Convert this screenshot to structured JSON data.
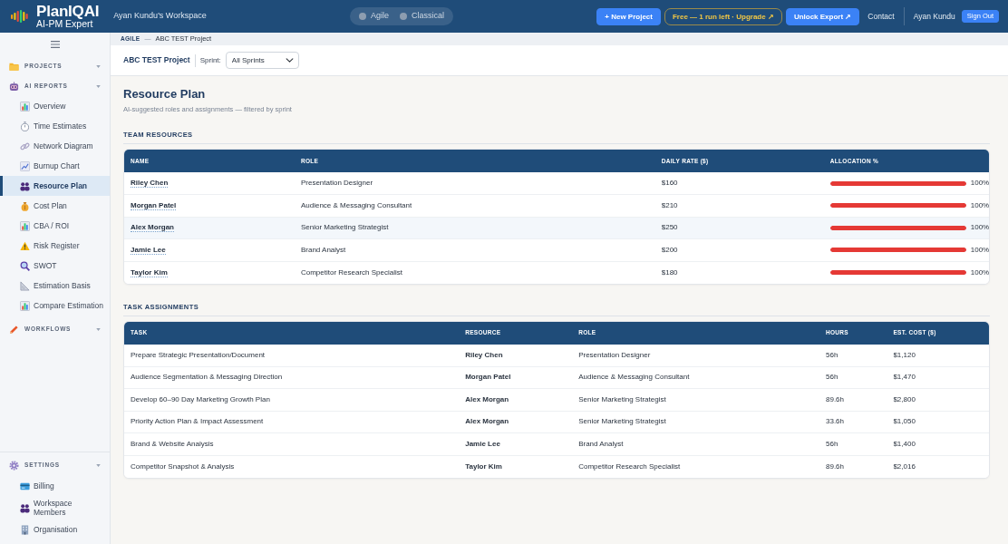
{
  "header": {
    "logo": {
      "title": "PlanIQAI",
      "subtitle": "AI-PM Expert"
    },
    "workspace": "Ayan Kundu's Workspace",
    "modes": [
      {
        "label": "Agile",
        "selected": false
      },
      {
        "label": "Classical",
        "selected": false
      }
    ],
    "new_project": "+ New Project",
    "upgrade": "Free — 1 run left · Upgrade ↗",
    "unlock_export": "Unlock Export ↗",
    "contact": "Contact",
    "user": "Ayan Kundu",
    "sign_out": "Sign Out"
  },
  "sidebar": {
    "sections": [
      {
        "label": "PROJECTS"
      },
      {
        "label": "AI REPORTS",
        "items": [
          {
            "label": "Overview",
            "selected": false
          },
          {
            "label": "Time Estimates",
            "selected": false
          },
          {
            "label": "Network Diagram",
            "selected": false
          },
          {
            "label": "Burnup Chart",
            "selected": false
          },
          {
            "label": "Resource Plan",
            "selected": true
          },
          {
            "label": "Cost Plan",
            "selected": false
          },
          {
            "label": "CBA / ROI",
            "selected": false
          },
          {
            "label": "Risk Register",
            "selected": false
          },
          {
            "label": "SWOT",
            "selected": false
          },
          {
            "label": "Estimation Basis",
            "selected": false
          },
          {
            "label": "Compare Estimation",
            "selected": false
          }
        ]
      },
      {
        "label": "WORKFLOWS"
      }
    ],
    "settings": {
      "label": "SETTINGS",
      "items": [
        {
          "label": "Billing",
          "selected": false
        },
        {
          "label": "Workspace Members",
          "selected": false
        },
        {
          "label": "Organisation",
          "selected": false
        }
      ]
    }
  },
  "breadcrumb": {
    "mode": "AGILE",
    "separator": "—",
    "project": "ABC TEST Project"
  },
  "project_bar": {
    "project": "ABC TEST Project",
    "sprint_label": "Sprint:",
    "sprint_select": {
      "value": "All Sprints"
    }
  },
  "page": {
    "title": "Resource Plan",
    "subtitle": "AI-suggested roles and assignments — filtered by sprint"
  },
  "team_resources": {
    "heading": "TEAM RESOURCES",
    "columns": [
      "NAME",
      "ROLE",
      "DAILY RATE ($)",
      "ALLOCATION %"
    ],
    "rows": [
      {
        "name": "Riley Chen",
        "role": "Presentation Designer",
        "rate": "$160",
        "level": 1,
        "allocation": "100%",
        "highlighted": false
      },
      {
        "name": "Morgan Patel",
        "role": "Audience & Messaging Consultant",
        "rate": "$210",
        "level": 1,
        "allocation": "100%",
        "highlighted": false
      },
      {
        "name": "Alex Morgan",
        "role": "Senior Marketing Strategist",
        "rate": "$250",
        "level": 1,
        "allocation": "100%",
        "highlighted": true
      },
      {
        "name": "Jamie Lee",
        "role": "Brand Analyst",
        "rate": "$200",
        "level": 1,
        "allocation": "100%",
        "highlighted": false
      },
      {
        "name": "Taylor Kim",
        "role": "Competitor Research Specialist",
        "rate": "$180",
        "level": 1,
        "allocation": "100%",
        "highlighted": false
      }
    ]
  },
  "task_assignments": {
    "heading": "TASK ASSIGNMENTS",
    "columns": [
      "TASK",
      "RESOURCE",
      "ROLE",
      "HOURS",
      "EST. COST ($)"
    ],
    "rows": [
      {
        "task": "Prepare Strategic Presentation/Document",
        "resource": "Riley Chen",
        "role": "Presentation Designer",
        "hours": "56h",
        "cost": "$1,120"
      },
      {
        "task": "Audience Segmentation & Messaging Direction",
        "resource": "Morgan Patel",
        "role": "Audience & Messaging Consultant",
        "hours": "56h",
        "cost": "$1,470"
      },
      {
        "task": "Develop 60–90 Day Marketing Growth Plan",
        "resource": "Alex Morgan",
        "role": "Senior Marketing Strategist",
        "hours": "89.6h",
        "cost": "$2,800"
      },
      {
        "task": "Priority Action Plan & Impact Assessment",
        "resource": "Alex Morgan",
        "role": "Senior Marketing Strategist",
        "hours": "33.6h",
        "cost": "$1,050"
      },
      {
        "task": "Brand & Website Analysis",
        "resource": "Jamie Lee",
        "role": "Brand Analyst",
        "hours": "56h",
        "cost": "$1,400"
      },
      {
        "task": "Competitor Snapshot & Analysis",
        "resource": "Taylor Kim",
        "role": "Competitor Research Specialist",
        "hours": "89.6h",
        "cost": "$2,016"
      }
    ]
  }
}
